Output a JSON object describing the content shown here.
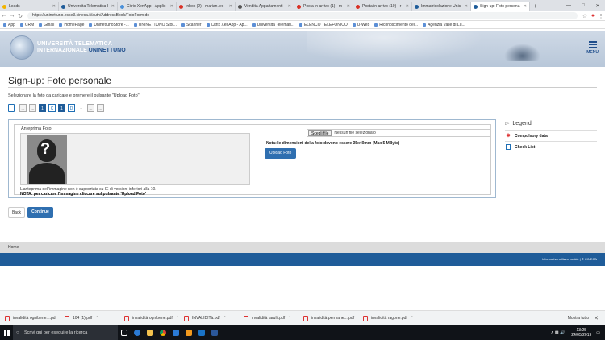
{
  "browser": {
    "tabs": [
      {
        "label": "Leads",
        "color": "#f2b400"
      },
      {
        "label": "Universita Telematica I",
        "color": "#1f5c99"
      },
      {
        "label": "Citrix XenApp - Applic",
        "color": "#4a90d9"
      },
      {
        "label": "Inbox (2) - marian.lec",
        "color": "#d93025"
      },
      {
        "label": "Vendita Appartamenti",
        "color": "#555555"
      },
      {
        "label": "Posta in arrivo (1) - m",
        "color": "#d93025"
      },
      {
        "label": "Posta in arrivo (10) - r",
        "color": "#d93025"
      },
      {
        "label": "Immatricolazione Unic",
        "color": "#1f5c99"
      },
      {
        "label": "Sign-up: Foto persona",
        "color": "#1f5c99",
        "active": true
      }
    ],
    "url": "https://uninettuno.esse3.cineca.it/auth/AddressBook/FotoForm.do",
    "bookmarks": [
      "App",
      "CRM",
      "Gmail",
      "HomePage",
      "UninettunoStore -...",
      "UNINETTUNO Stor...",
      "Scanner",
      "Citrix XenApp - Ap...",
      "Università Telemati...",
      "ELENCO TELEFONICO",
      "U-Web",
      "Riconoscimento dei...",
      "Agenzia Valle di Lu..."
    ]
  },
  "header": {
    "line1": "UNIVERSITÀ TELEMATICA",
    "line2_prefix": "INTERNAZIONALE",
    "line2_brand": "UNINETTUNO",
    "menu_label": "MENU"
  },
  "page": {
    "title": "Sign-up: Foto personale",
    "instruction": "Selezionare la foto da caricare e premere il pulsante \"Upload Foto\".",
    "steps": [
      "...",
      "...",
      "1",
      "C",
      "1",
      "D",
      "1",
      "...",
      "..."
    ]
  },
  "photo": {
    "legend": "Anteprima Foto",
    "note_ie": "L'anteprima dell'immagine non è supportata su IE di versioni inferiori alla 10.",
    "note_upload": "NOTA: per caricare l'immagine cliccare sul pulsante 'Upload Foto'",
    "file_button": "Scegli file",
    "file_status": "Nessun file selezionato",
    "dimension_note": "Nota: le dimensioni della foto devono essere 35x40mm (Max 5 MByte)",
    "upload_button": "Upload Foto"
  },
  "actions": {
    "back": "Back",
    "continue": "Continue"
  },
  "legend_panel": {
    "title": "Legend",
    "items": [
      {
        "label": "Compulsory data",
        "icon": "asterisk-icon"
      },
      {
        "label": "Check List",
        "icon": "checklist-icon"
      }
    ]
  },
  "footer": {
    "home": "Home",
    "cookie": "Informativa utilizzo cookie | © CINECA"
  },
  "downloads": {
    "items": [
      "invalidità ognibene....pdf",
      "104 (1).pdf",
      "invalidità ognibene.pdf",
      "INVALIDITà.pdf",
      "invalidità tarulli.pdf",
      "invalidità permane....pdf",
      "invalidità ragone.pdf"
    ],
    "show_all": "Mostra tutto"
  },
  "taskbar": {
    "search": "Scrivi qui per eseguire la ricerca",
    "time": "13:25",
    "date": "24/05/2019"
  }
}
